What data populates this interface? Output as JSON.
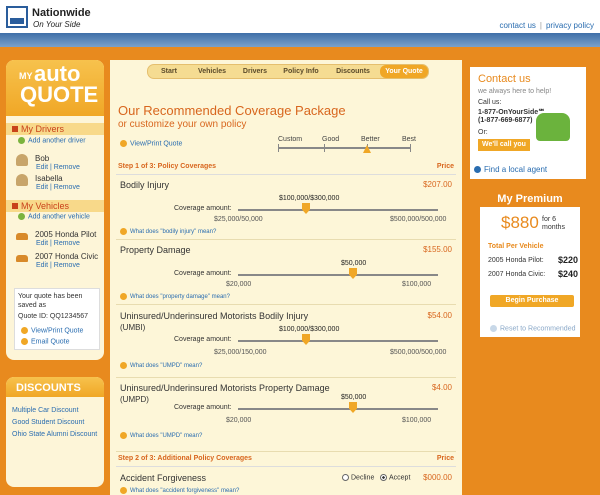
{
  "header": {
    "brand": "Nationwide",
    "tagline": "On Your Side",
    "links": [
      "contact us",
      "privacy policy"
    ]
  },
  "sidebar": {
    "logo_my": "MY",
    "logo_auto": "auto",
    "logo_quote": "QUOTE",
    "drivers_title": "My Drivers",
    "add_driver": "Add another driver",
    "drivers": [
      {
        "name": "Bob",
        "links": "Edit | Remove"
      },
      {
        "name": "Isabella",
        "links": "Edit | Remove"
      }
    ],
    "vehicles_title": "My Vehicles",
    "add_vehicle": "Add another vehicle",
    "vehicles": [
      {
        "name": "2005 Honda Pilot",
        "links": "Edit | Remove"
      },
      {
        "name": "2007 Honda Civic",
        "links": "Edit | Remove"
      }
    ],
    "saved_text": "Your quote has been saved as",
    "quote_id": "Quote ID: QQ1234567",
    "view_print": "View/Print Quote",
    "email_quote": "Email Quote"
  },
  "discounts": {
    "title": "DISCOUNTS",
    "items": [
      "Multiple Car Discount",
      "Good Student Discount",
      "Ohio State Alumni Discount"
    ]
  },
  "tabs": [
    "Start",
    "Vehicles",
    "Drivers",
    "Policy Info",
    "Discounts",
    "Your Quote"
  ],
  "main": {
    "title": "Our Recommended Coverage Package",
    "subtitle": "or customize your own policy",
    "view_print": "View/Print Quote",
    "levels": [
      "Custom",
      "Good",
      "Better",
      "Best"
    ],
    "selected_level": "Better",
    "step1": {
      "title": "Step 1 of 3: Policy Coverages",
      "price_label": "Price"
    },
    "step2": {
      "title": "Step 2 of 3: Additional Policy Coverages",
      "price_label": "Price"
    },
    "amount_label": "Coverage amount:",
    "coverages": [
      {
        "name": "Bodily Injury",
        "sub": "",
        "price": "$207.00",
        "value": "$100,000/$300,000",
        "min": "$25,000/50,000",
        "max": "$500,000/500,000",
        "what": "What does \"bodily injury\" mean?",
        "level": 0.4
      },
      {
        "name": "Property Damage",
        "sub": "",
        "price": "$155.00",
        "value": "$50,000",
        "min": "$20,000",
        "max": "$100,000",
        "what": "What does \"property damage\" mean?",
        "level": 0.5
      },
      {
        "name": "Uninsured/Underinsured Motorists Bodily Injury",
        "sub": "(UMBI)",
        "price": "$54.00",
        "value": "$100,000/$300,000",
        "min": "$25,000/150,000",
        "max": "$500,000/500,000",
        "what": "What does \"UMPD\" mean?",
        "level": 0.4
      },
      {
        "name": "Uninsured/Underinsured Motorists Property Damage",
        "sub": "(UMPD)",
        "price": "$4.00",
        "value": "$50,000",
        "min": "$20,000",
        "max": "$100,000",
        "what": "What does \"UMPD\" mean?",
        "level": 0.5
      }
    ],
    "forgiveness": {
      "name": "Accident Forgiveness",
      "decline": "Decline",
      "accept": "Accept",
      "price": "$000.00",
      "what": "What does \"accident forgiveness\" mean?"
    }
  },
  "contact": {
    "title": "Contact us",
    "subtitle": "we always here to help!",
    "call_label": "Call us:",
    "phone1": "1-877-OnYourSide℠",
    "phone2": "(1-877-669-6877)",
    "or": "Or:",
    "call_button": "We'll call you",
    "find_agent": "Find a local agent"
  },
  "premium": {
    "title": "My Premium",
    "amount": "$880",
    "term": "for 6 months",
    "total_label": "Total Per Vehicle",
    "vehicles": [
      {
        "name": "2005 Honda Pilot:",
        "price": "$220"
      },
      {
        "name": "2007 Honda Civic:",
        "price": "$240"
      }
    ],
    "purchase_button": "Begin Purchase",
    "reset": "Reset to Recommended"
  }
}
